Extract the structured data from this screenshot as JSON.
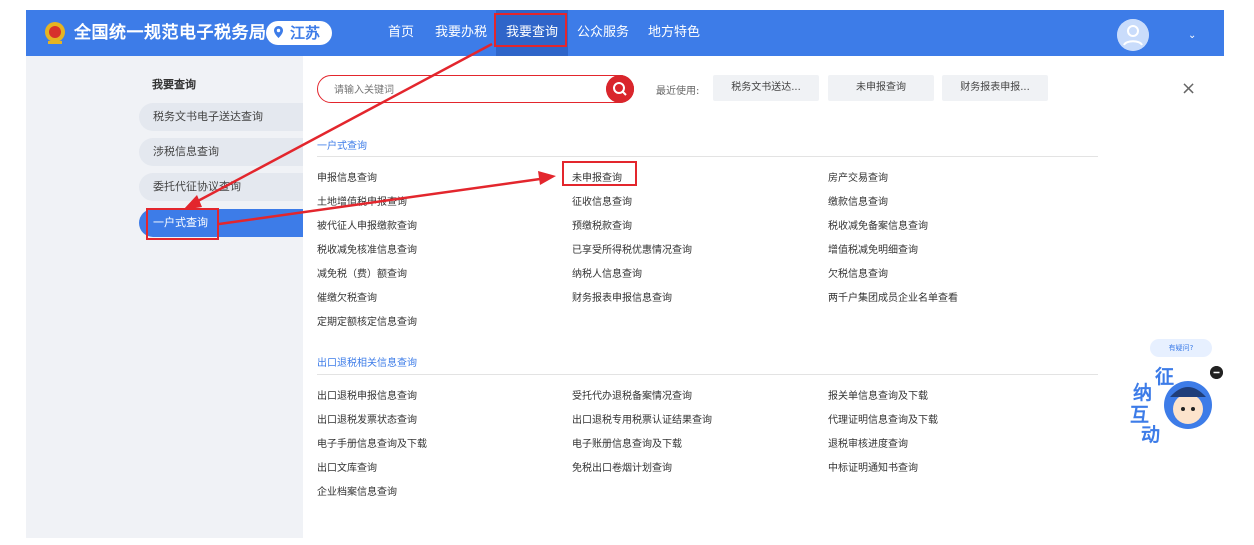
{
  "header": {
    "brand": "全国统一规范电子税务局",
    "province": "江苏",
    "nav": [
      "首页",
      "我要办税",
      "我要查询",
      "公众服务",
      "地方特色"
    ],
    "caret": "⌄"
  },
  "sidebar": {
    "title": "我要查询",
    "items": [
      "税务文书电子送达查询",
      "涉税信息查询",
      "委托代征协议查询",
      "一户式查询"
    ]
  },
  "search": {
    "placeholder": "请输入关键词",
    "recent_label": "最近使用:",
    "recent": [
      "税务文书送达...",
      "未申报查询",
      "财务报表申报..."
    ],
    "close": "×"
  },
  "sections": [
    {
      "title": "一户式查询",
      "links": [
        "申报信息查询",
        "未申报查询",
        "房产交易查询",
        "土地增值税申报查询",
        "征收信息查询",
        "缴款信息查询",
        "被代征人申报缴款查询",
        "预缴税款查询",
        "税收减免备案信息查询",
        "税收减免核准信息查询",
        "已享受所得税优惠情况查询",
        "增值税减免明细查询",
        "减免税（费）额查询",
        "纳税人信息查询",
        "欠税信息查询",
        "催缴欠税查询",
        "财务报表申报信息查询",
        "两千户集团成员企业名单查看",
        "定期定额核定信息查询"
      ]
    },
    {
      "title": "出口退税相关信息查询",
      "links": [
        "出口退税申报信息查询",
        "受托代办退税备案情况查询",
        "报关单信息查询及下载",
        "出口退税发票状态查询",
        "出口退税专用税票认证结果查询",
        "代理证明信息查询及下载",
        "电子手册信息查询及下载",
        "电子账册信息查询及下载",
        "退税审核进度查询",
        "出口文库查询",
        "免税出口卷烟计划查询",
        "中标证明通知书查询",
        "企业档案信息查询"
      ]
    }
  ],
  "mascot": {
    "tag": "有疑问?",
    "chars": [
      "征",
      "纳",
      "互",
      "动"
    ]
  },
  "colors": {
    "brand": "#3d7ce8",
    "highlight": "#e3262d"
  }
}
